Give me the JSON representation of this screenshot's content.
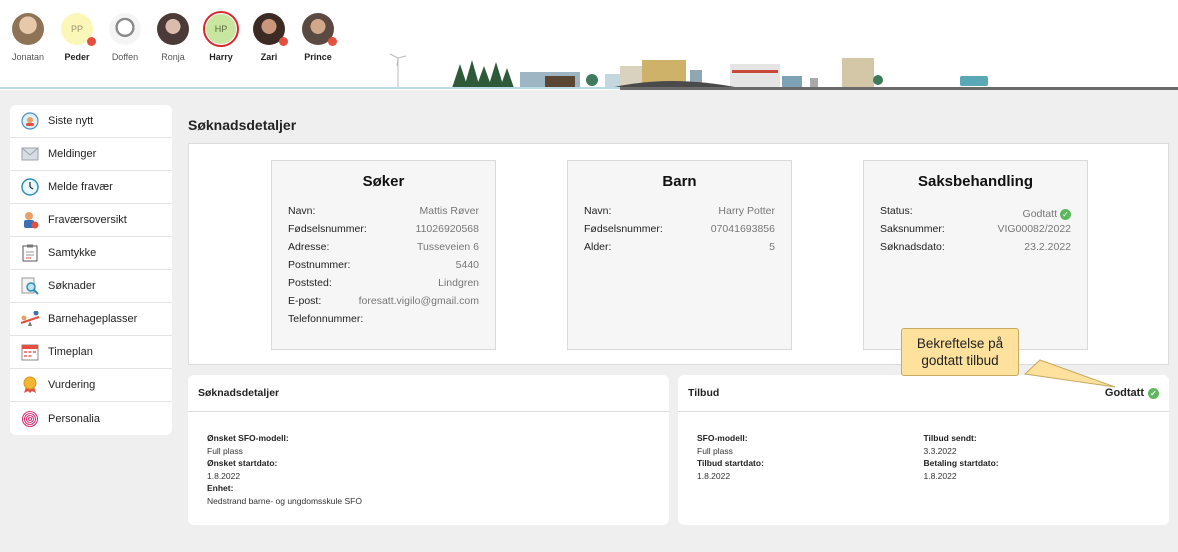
{
  "children": [
    {
      "name": "Jonatan",
      "initials": "",
      "bold": false,
      "dot": false,
      "color": "#c9a98d"
    },
    {
      "name": "Peder",
      "initials": "PP",
      "bold": true,
      "dot": true,
      "color": "#fbf7b9"
    },
    {
      "name": "Doffen",
      "initials": "",
      "bold": false,
      "dot": false,
      "color": "#dddddd"
    },
    {
      "name": "Ronja",
      "initials": "",
      "bold": false,
      "dot": false,
      "color": "#7b6c66"
    },
    {
      "name": "Harry",
      "initials": "HP",
      "bold": true,
      "dot": false,
      "color": "#c8e6a0"
    },
    {
      "name": "Zari",
      "initials": "",
      "bold": true,
      "dot": true,
      "color": "#6a4f45"
    },
    {
      "name": "Prince",
      "initials": "",
      "bold": true,
      "dot": true,
      "color": "#8a7a70"
    }
  ],
  "sidebar": {
    "items": [
      {
        "label": "Siste nytt",
        "icon": "news-icon"
      },
      {
        "label": "Meldinger",
        "icon": "envelope-icon"
      },
      {
        "label": "Melde fravær",
        "icon": "clock-icon"
      },
      {
        "label": "Fraværsoversikt",
        "icon": "absence-icon"
      },
      {
        "label": "Samtykke",
        "icon": "consent-icon"
      },
      {
        "label": "Søknader",
        "icon": "search-document-icon"
      },
      {
        "label": "Barnehageplasser",
        "icon": "seesaw-icon"
      },
      {
        "label": "Timeplan",
        "icon": "calendar-icon"
      },
      {
        "label": "Vurdering",
        "icon": "medal-icon"
      },
      {
        "label": "Personalia",
        "icon": "fingerprint-icon"
      }
    ]
  },
  "page": {
    "title": "Søknadsdetaljer"
  },
  "soker": {
    "title": "Søker",
    "rows": [
      {
        "k": "Navn:",
        "v": "Mattis Røver"
      },
      {
        "k": "Fødselsnummer:",
        "v": "11026920568"
      },
      {
        "k": "Adresse:",
        "v": "Tusseveien 6"
      },
      {
        "k": "Postnummer:",
        "v": "5440"
      },
      {
        "k": "Poststed:",
        "v": "Lindgren"
      },
      {
        "k": "E-post:",
        "v": "foresatt.vigilo@gmail.com"
      },
      {
        "k": "Telefonnummer:",
        "v": ""
      }
    ]
  },
  "barn": {
    "title": "Barn",
    "rows": [
      {
        "k": "Navn:",
        "v": "Harry Potter"
      },
      {
        "k": "Fødselsnummer:",
        "v": "07041693856"
      },
      {
        "k": "Alder:",
        "v": "5"
      }
    ]
  },
  "saksbehandling": {
    "title": "Saksbehandling",
    "status_label": "Status:",
    "status_value": "Godtatt",
    "rows": [
      {
        "k": "Saksnummer:",
        "v": "VIG00082/2022"
      },
      {
        "k": "Søknadsdato:",
        "v": "23.2.2022"
      }
    ]
  },
  "soknadsdetaljer": {
    "title": "Søknadsdetaljer",
    "model_label": "Ønsket SFO-modell:",
    "model_value": "Full plass",
    "start_label": "Ønsket startdato:",
    "start_value": "1.8.2022",
    "unit_label": "Enhet:",
    "unit_value": "Nedstrand barne- og ungdomsskule SFO"
  },
  "tilbud": {
    "title": "Tilbud",
    "status": "Godtatt",
    "model_label": "SFO-modell:",
    "model_value": "Full plass",
    "start_label": "Tilbud startdato:",
    "start_value": "1.8.2022",
    "sent_label": "Tilbud sendt:",
    "sent_value": "3.3.2022",
    "pay_label": "Betaling startdato:",
    "pay_value": "1.8.2022"
  },
  "callout": {
    "line1": "Bekreftelse på",
    "line2": "godtatt tilbud"
  },
  "colors": {
    "accent": "#5cb85c",
    "alert": "#e4503f",
    "callout": "#fde19d",
    "selected_ring": "#d9262c"
  }
}
